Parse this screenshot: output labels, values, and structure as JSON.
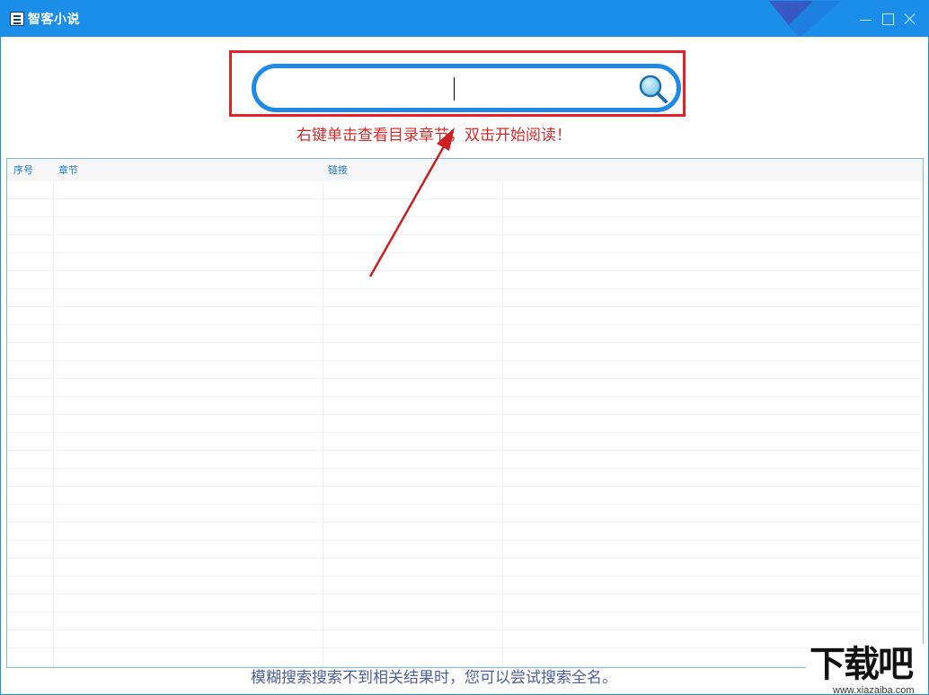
{
  "window": {
    "title": "智客小说",
    "controls": {
      "minimize": "minimize-icon",
      "maximize": "maximize-icon",
      "close": "close-icon"
    }
  },
  "search": {
    "value": "",
    "placeholder": "",
    "button_icon": "search-icon"
  },
  "hint_text": "右键单击查看目录章节，双击开始阅读！",
  "table": {
    "columns": [
      "序号",
      "章节",
      "链接"
    ],
    "rows": []
  },
  "footer_hint": "模糊搜索搜索不到相关结果时，您可以尝试搜索全名。",
  "watermark": {
    "brand": "下载吧",
    "url": "www.xiazaiba.com"
  },
  "colors": {
    "titlebar": "#1a8ee9",
    "accent": "#1f8ae6",
    "highlight": "#e5202a",
    "hint": "#d62a2a",
    "footer": "#4c5fa0",
    "header_text": "#1d79c8"
  }
}
